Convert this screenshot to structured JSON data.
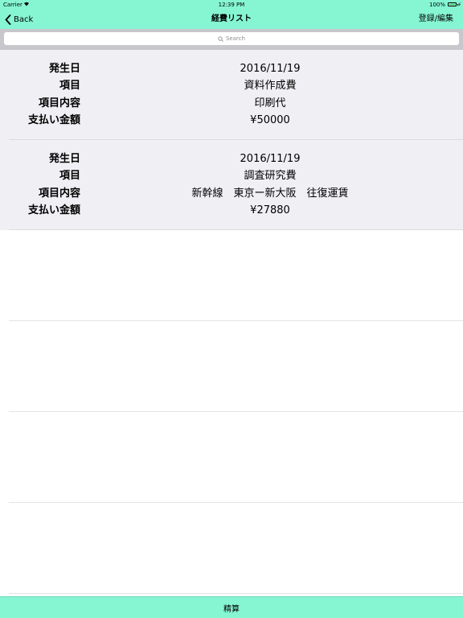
{
  "status_bar": {
    "carrier": "Carrier",
    "time": "12:39 PM",
    "battery_percent": "100%"
  },
  "nav": {
    "back_label": "Back",
    "title": "経費リスト",
    "right_label": "登録/編集"
  },
  "search": {
    "placeholder": "Search"
  },
  "records": [
    {
      "labels": [
        "発生日",
        "項目",
        "項目内容",
        "支払い金額"
      ],
      "date": "2016/11/19",
      "category": "資料作成費",
      "description": "印刷代",
      "amount": "¥50000"
    },
    {
      "labels": [
        "発生日",
        "項目",
        "項目内容",
        "支払い金額"
      ],
      "date": "2016/11/19",
      "category": "調査研究費",
      "description": "新幹線　東京ー新大阪　往復運賃",
      "amount": "¥27880"
    }
  ],
  "toolbar": {
    "settle_label": "精算"
  },
  "colors": {
    "accent": "#86f5d2",
    "record_background": "#efeff4",
    "search_area": "#c7c7cc"
  }
}
